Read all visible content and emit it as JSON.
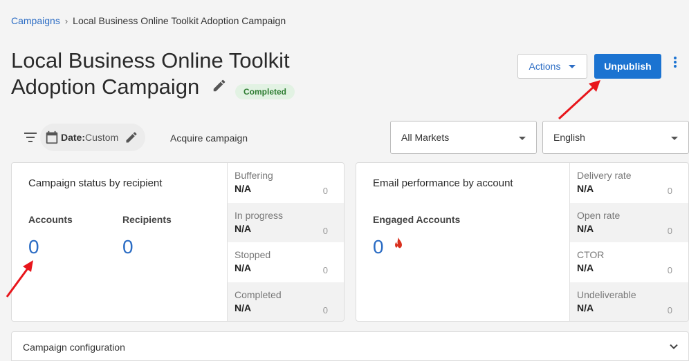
{
  "breadcrumb": {
    "parent": "Campaigns",
    "separator": "›",
    "current": "Local Business Online Toolkit Adoption Campaign"
  },
  "header": {
    "title": "Local Business Online Toolkit Adoption Campaign",
    "status": "Completed",
    "actions_label": "Actions",
    "unpublish_label": "Unpublish"
  },
  "filters": {
    "date_label": "Date:",
    "date_value": "Custom",
    "campaign_type": "Acquire campaign",
    "market": "All Markets",
    "language": "English"
  },
  "status_card": {
    "title": "Campaign status by recipient",
    "metrics": [
      {
        "label": "Accounts",
        "value": "0"
      },
      {
        "label": "Recipients",
        "value": "0"
      }
    ],
    "rows": [
      {
        "label": "Buffering",
        "value": "N/A",
        "count": "0"
      },
      {
        "label": "In progress",
        "value": "N/A",
        "count": "0"
      },
      {
        "label": "Stopped",
        "value": "N/A",
        "count": "0"
      },
      {
        "label": "Completed",
        "value": "N/A",
        "count": "0"
      }
    ]
  },
  "email_card": {
    "title": "Email performance by account",
    "metric": {
      "label": "Engaged Accounts",
      "value": "0"
    },
    "rows": [
      {
        "label": "Delivery rate",
        "value": "N/A",
        "count": "0"
      },
      {
        "label": "Open rate",
        "value": "N/A",
        "count": "0"
      },
      {
        "label": "CTOR",
        "value": "N/A",
        "count": "0"
      },
      {
        "label": "Undeliverable",
        "value": "N/A",
        "count": "0"
      }
    ]
  },
  "config_panel": {
    "title": "Campaign configuration"
  },
  "colors": {
    "accent": "#1b73d1",
    "link": "#2b6cc4",
    "status_bg": "#e2f2e3",
    "status_text": "#2e7d32",
    "annotation": "#e8151b"
  },
  "icons": [
    "filter-icon",
    "calendar-icon",
    "pencil-icon",
    "flame-icon",
    "more-vertical-icon",
    "chevron-down-icon"
  ]
}
